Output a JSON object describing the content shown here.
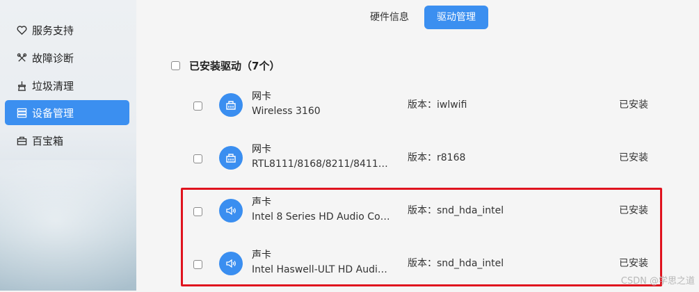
{
  "sidebar": {
    "items": [
      {
        "label": "服务支持",
        "icon": "heart-shield-icon",
        "active": false
      },
      {
        "label": "故障诊断",
        "icon": "tools-icon",
        "active": false
      },
      {
        "label": "垃圾清理",
        "icon": "broom-icon",
        "active": false
      },
      {
        "label": "设备管理",
        "icon": "device-list-icon",
        "active": true
      },
      {
        "label": "百宝箱",
        "icon": "toolbox-icon",
        "active": false
      }
    ]
  },
  "tabs": [
    {
      "label": "硬件信息",
      "active": false
    },
    {
      "label": "驱动管理",
      "active": true
    }
  ],
  "section": {
    "title": "已安装驱动（7个）"
  },
  "drivers": [
    {
      "type": "网卡",
      "model": "Wireless 3160",
      "version": "版本：iwlwifi",
      "status": "已安装",
      "icon": "network-card-icon"
    },
    {
      "type": "网卡",
      "model": "RTL8111/8168/8211/8411 …",
      "version": "版本：r8168",
      "status": "已安装",
      "icon": "network-card-icon"
    },
    {
      "type": "声卡",
      "model": "Intel 8 Series HD Audio Co…",
      "version": "版本：snd_hda_intel",
      "status": "已安装",
      "icon": "speaker-icon"
    },
    {
      "type": "声卡",
      "model": "Intel Haswell-ULT HD Audi…",
      "version": "版本：snd_hda_intel",
      "status": "已安装",
      "icon": "speaker-icon"
    }
  ],
  "watermark": "CSDN @学思之道",
  "colors": {
    "accent": "#3b8ff0",
    "highlight": "#e0131e"
  }
}
